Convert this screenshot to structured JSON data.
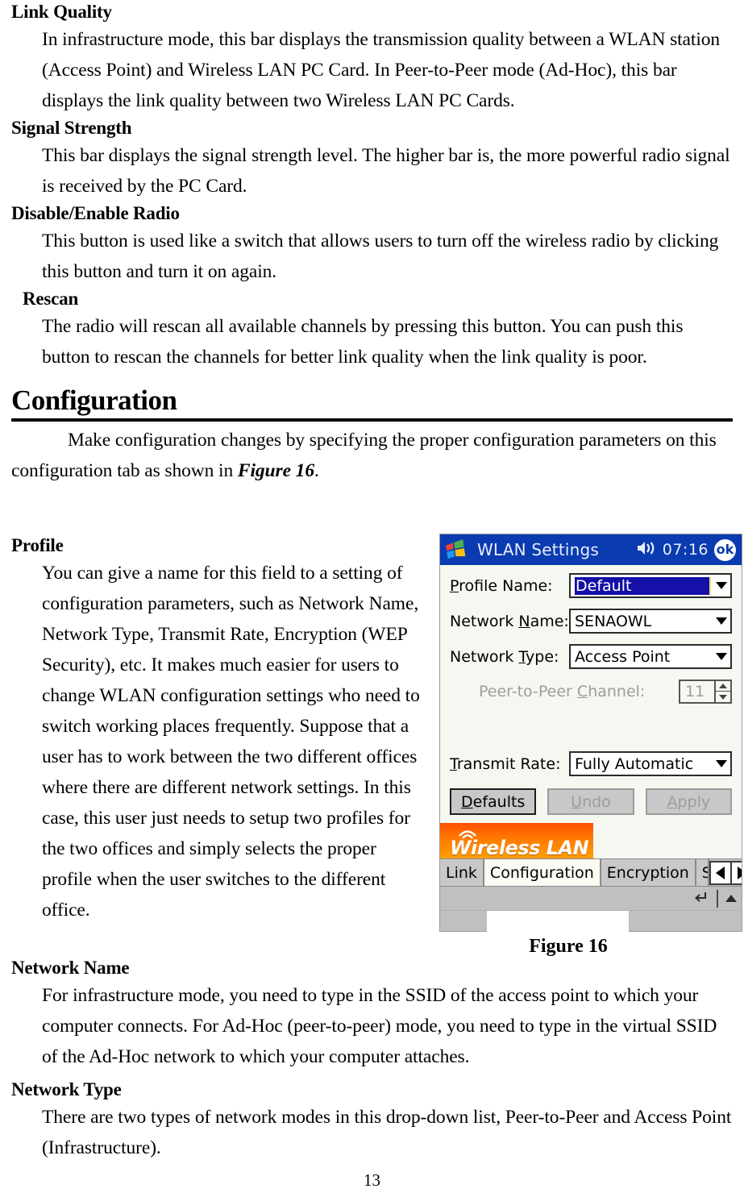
{
  "document": {
    "page_number": "13",
    "sections": [
      {
        "heading": "Link Quality",
        "body": "In infrastructure mode, this bar displays the transmission quality between a WLAN station (Access Point) and Wireless LAN PC Card. In Peer-to-Peer mode (Ad-Hoc), this bar displays the link quality between two Wireless LAN PC Cards."
      },
      {
        "heading": "Signal Strength",
        "body": "This bar displays the signal strength level. The higher bar is, the more powerful radio signal is received by the PC Card."
      },
      {
        "heading": "Disable/Enable Radio",
        "body": "This button is used like a switch that allows users to turn off the wireless radio by clicking this button and turn it on again."
      },
      {
        "heading": "Rescan",
        "body": "The radio will rescan all available channels by pressing this button. You can push this button to rescan the channels for better link quality when the link quality is poor."
      }
    ],
    "chapter": {
      "title": "Configuration",
      "intro_before": "Make configuration changes by specifying the proper configuration parameters on this configuration tab as shown in ",
      "intro_emphasis": "Figure 16",
      "intro_after": "."
    },
    "profile": {
      "heading": "Profile",
      "body": "You can give a name for this field to a setting of configuration parameters, such as Network Name, Network Type, Transmit Rate, Encryption (WEP Security), etc. It makes much easier for users to change WLAN configuration settings who need to switch working places frequently. Suppose that a user has to work between the two different offices where there are different network settings. In this case, this user just needs to setup two profiles for the two offices and simply selects the proper profile when the user switches to the different office."
    },
    "figure_caption": "Figure 16",
    "sections_after": [
      {
        "heading": "Network Name",
        "body": "For infrastructure mode, you need to type in the SSID of the access point to which your computer connects. For Ad-Hoc (peer-to-peer) mode, you need to type in the virtual SSID of the Ad-Hoc network to which your computer attaches."
      },
      {
        "heading": "Network Type",
        "body": "There are two types of network modes in this drop-down list, Peer-to-Peer and Access Point (Infrastructure)."
      }
    ]
  },
  "screenshot": {
    "titlebar": {
      "app_title": "WLAN Settings",
      "clock": "07:16",
      "ok_label": "ok",
      "accent_color": "#0a3bb0"
    },
    "fields": {
      "profile_name": {
        "label_pre": "P",
        "label_post": "rofile Name:",
        "value": "Default"
      },
      "network_name": {
        "label_pre": "Network ",
        "label_key": "N",
        "label_post": "ame:",
        "value": "SENAOWL"
      },
      "network_type": {
        "label_pre": "Network ",
        "label_key": "T",
        "label_post": "ype:",
        "value": "Access Point"
      },
      "peer_channel": {
        "label_pre": "Peer-to-Peer ",
        "label_key": "C",
        "label_post": "hannel:",
        "value": "11",
        "disabled": true
      },
      "transmit_rate": {
        "label_pre": "T",
        "label_post": "ransmit Rate:",
        "value": "Fully Automatic"
      }
    },
    "buttons": [
      {
        "key": "D",
        "rest": "efaults",
        "enabled": true
      },
      {
        "key": "U",
        "rest": "ndo",
        "enabled": false
      },
      {
        "key": "A",
        "rest": "pply",
        "enabled": false
      }
    ],
    "banner_text": "Wireless LAN",
    "banner_color": "#ff7b00",
    "tabs": [
      {
        "label": "Link",
        "active": false
      },
      {
        "label": "Configuration",
        "active": true
      },
      {
        "label": "Encryption",
        "active": false
      },
      {
        "label": "Site",
        "active": false
      }
    ]
  }
}
